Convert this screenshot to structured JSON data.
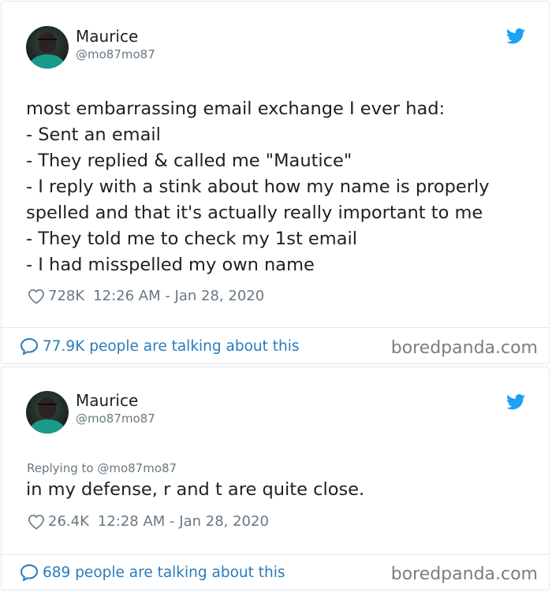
{
  "tweets": [
    {
      "author_name": "Maurice",
      "author_handle": "@mo87mo87",
      "replying_to": "",
      "text_lines": [
        "most embarrassing email exchange I ever had:",
        "- Sent an email",
        "- They replied & called me \"Mautice\"",
        "- I reply with a stink about how my name is properly",
        "spelled and that it's actually really important to me",
        "- They told me to check my 1st email",
        "- I had misspelled my own name"
      ],
      "likes": "728K",
      "timestamp": "12:26 AM - Jan 28, 2020",
      "talking": "77.9K people are talking about this",
      "watermark": "boredpanda.com"
    },
    {
      "author_name": "Maurice",
      "author_handle": "@mo87mo87",
      "replying_to": "Replying to @mo87mo87",
      "text_lines": [
        "in my defense, r and t are quite close."
      ],
      "likes": "26.4K",
      "timestamp": "12:28 AM - Jan 28, 2020",
      "talking": "689 people are talking about this",
      "watermark": "boredpanda.com"
    }
  ],
  "icons": {
    "bird": "twitter-bird-icon",
    "heart": "heart-icon",
    "speech": "speech-bubble-icon"
  },
  "colors": {
    "twitter_blue": "#1da1f2",
    "link_blue": "#2b7bb9",
    "muted_gray": "#697882",
    "border": "#e1e8ed"
  }
}
